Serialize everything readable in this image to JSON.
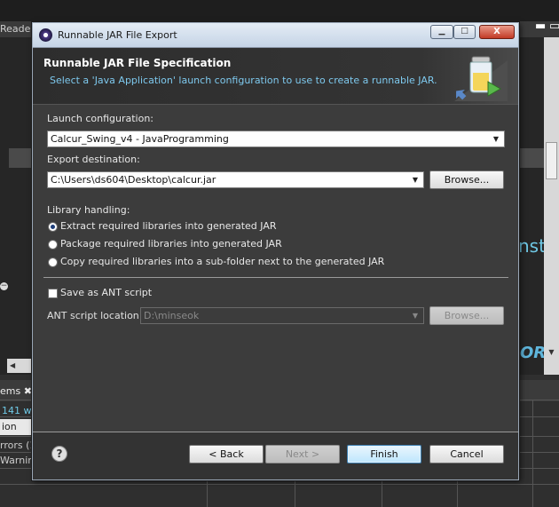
{
  "background": {
    "reade_label": "Reade",
    "problems_tab": "ems",
    "problems_count": "141 w",
    "selected_row": "ion",
    "row_errors": "rrors (1",
    "row_warnings": "Warning",
    "nst_text": "nst",
    "or_text": "OR"
  },
  "dialog": {
    "title": "Runnable JAR File Export",
    "win_minimize": "▁",
    "win_maximize": "□",
    "win_close": "X",
    "header": {
      "title": "Runnable JAR File Specification",
      "description": "Select a 'Java Application' launch configuration to use to create a runnable JAR."
    },
    "launch": {
      "label": "Launch configuration:",
      "value": "Calcur_Swing_v4 - JavaProgramming"
    },
    "export": {
      "label": "Export destination:",
      "value": "C:\\Users\\ds604\\Desktop\\calcur.jar",
      "browse": "Browse..."
    },
    "library": {
      "label": "Library handling:",
      "options": [
        "Extract required libraries into generated JAR",
        "Package required libraries into generated JAR",
        "Copy required libraries into a sub-folder next to the generated JAR"
      ],
      "selected_index": 0
    },
    "ant": {
      "save_label": "Save as ANT script",
      "checked": false,
      "location_label": "ANT script location:",
      "location_value": "D:\\minseok",
      "browse": "Browse..."
    },
    "buttons": {
      "help": "?",
      "back": "< Back",
      "next": "Next >",
      "finish": "Finish",
      "cancel": "Cancel"
    }
  },
  "colors": {
    "accent_text": "#7ec9ee",
    "dialog_bg": "#3c3c3c",
    "default_button": "#bee6fd"
  }
}
